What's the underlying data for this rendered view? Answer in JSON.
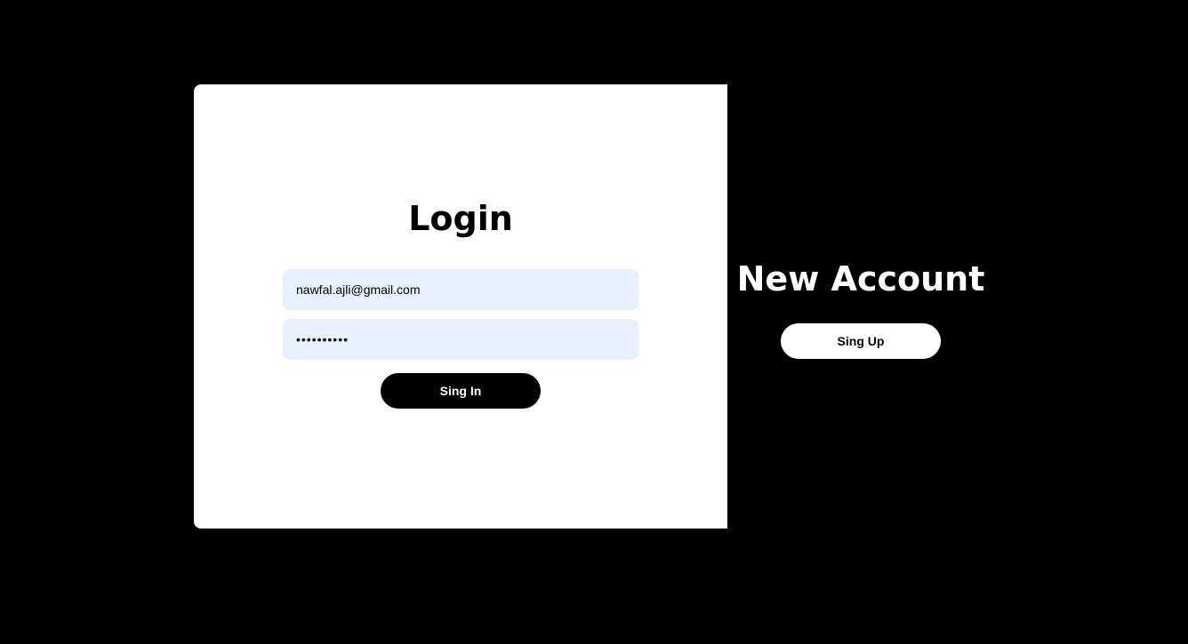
{
  "login": {
    "title": "Login",
    "email_value": "nawfal.ajli@gmail.com",
    "password_value": "••••••••••",
    "signin_label": "Sing In"
  },
  "signup": {
    "title": "New Account",
    "signup_label": "Sing Up"
  },
  "colors": {
    "background": "#000000",
    "card": "#ffffff",
    "input_fill": "#e8f0fe"
  }
}
